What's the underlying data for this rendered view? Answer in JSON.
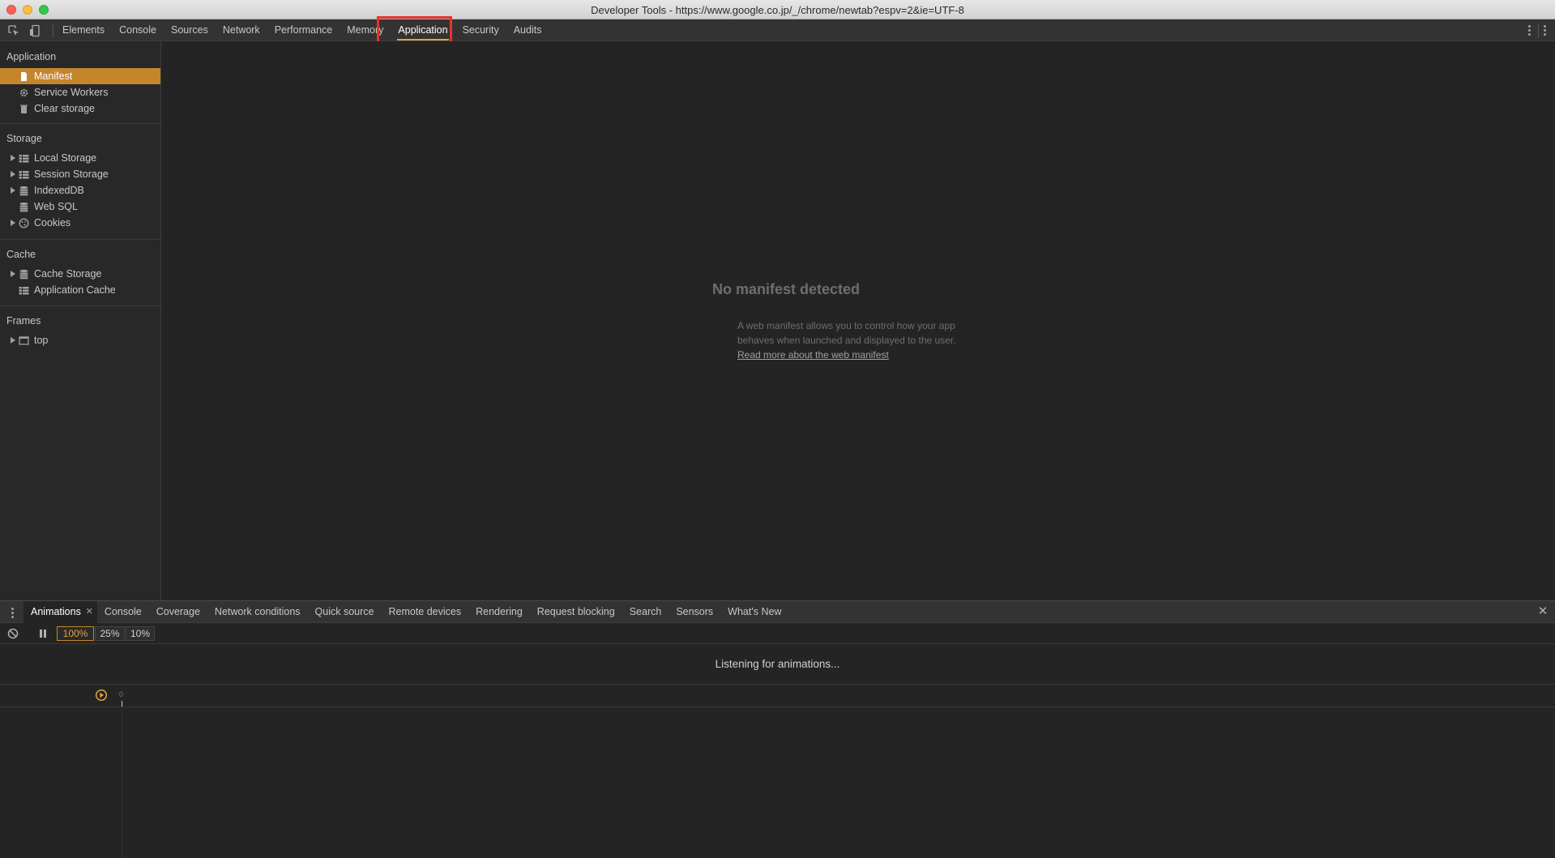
{
  "window": {
    "title": "Developer Tools - https://www.google.co.jp/_/chrome/newtab?espv=2&ie=UTF-8"
  },
  "toolbar": {
    "tabs": [
      "Elements",
      "Console",
      "Sources",
      "Network",
      "Performance",
      "Memory",
      "Application",
      "Security",
      "Audits"
    ],
    "active_tab": "Application",
    "icons": [
      "inspect-element-icon",
      "device-toolbar-icon",
      "more-options-icon"
    ]
  },
  "sidebar": {
    "sections": [
      {
        "title": "Application",
        "items": [
          {
            "label": "Manifest",
            "icon": "file-icon",
            "selected": true
          },
          {
            "label": "Service Workers",
            "icon": "gear-icon"
          },
          {
            "label": "Clear storage",
            "icon": "trash-icon"
          }
        ]
      },
      {
        "title": "Storage",
        "items": [
          {
            "label": "Local Storage",
            "icon": "grid-icon",
            "expandable": true
          },
          {
            "label": "Session Storage",
            "icon": "grid-icon",
            "expandable": true
          },
          {
            "label": "IndexedDB",
            "icon": "database-icon",
            "expandable": true
          },
          {
            "label": "Web SQL",
            "icon": "database-icon"
          },
          {
            "label": "Cookies",
            "icon": "cookie-icon",
            "expandable": true
          }
        ]
      },
      {
        "title": "Cache",
        "items": [
          {
            "label": "Cache Storage",
            "icon": "database-icon",
            "expandable": true
          },
          {
            "label": "Application Cache",
            "icon": "grid-icon"
          }
        ]
      },
      {
        "title": "Frames",
        "items": [
          {
            "label": "top",
            "icon": "frame-icon",
            "expandable": true
          }
        ]
      }
    ]
  },
  "main": {
    "empty_title": "No manifest detected",
    "empty_desc": "A web manifest allows you to control how your app behaves when launched and displayed to the user.",
    "link_text": "Read more about the web manifest"
  },
  "drawer": {
    "tabs": [
      "Animations",
      "Console",
      "Coverage",
      "Network conditions",
      "Quick source",
      "Remote devices",
      "Rendering",
      "Request blocking",
      "Search",
      "Sensors",
      "What's New"
    ],
    "active_tab": "Animations",
    "speeds": [
      "100%",
      "25%",
      "10%"
    ],
    "active_speed": "100%",
    "listening_text": "Listening for animations...",
    "timeline_zero": "0"
  },
  "colors": {
    "accent": "#e3a341",
    "selected_bg": "#c4852d",
    "highlight_box": "#e8332b",
    "panel_bg": "#242424"
  }
}
